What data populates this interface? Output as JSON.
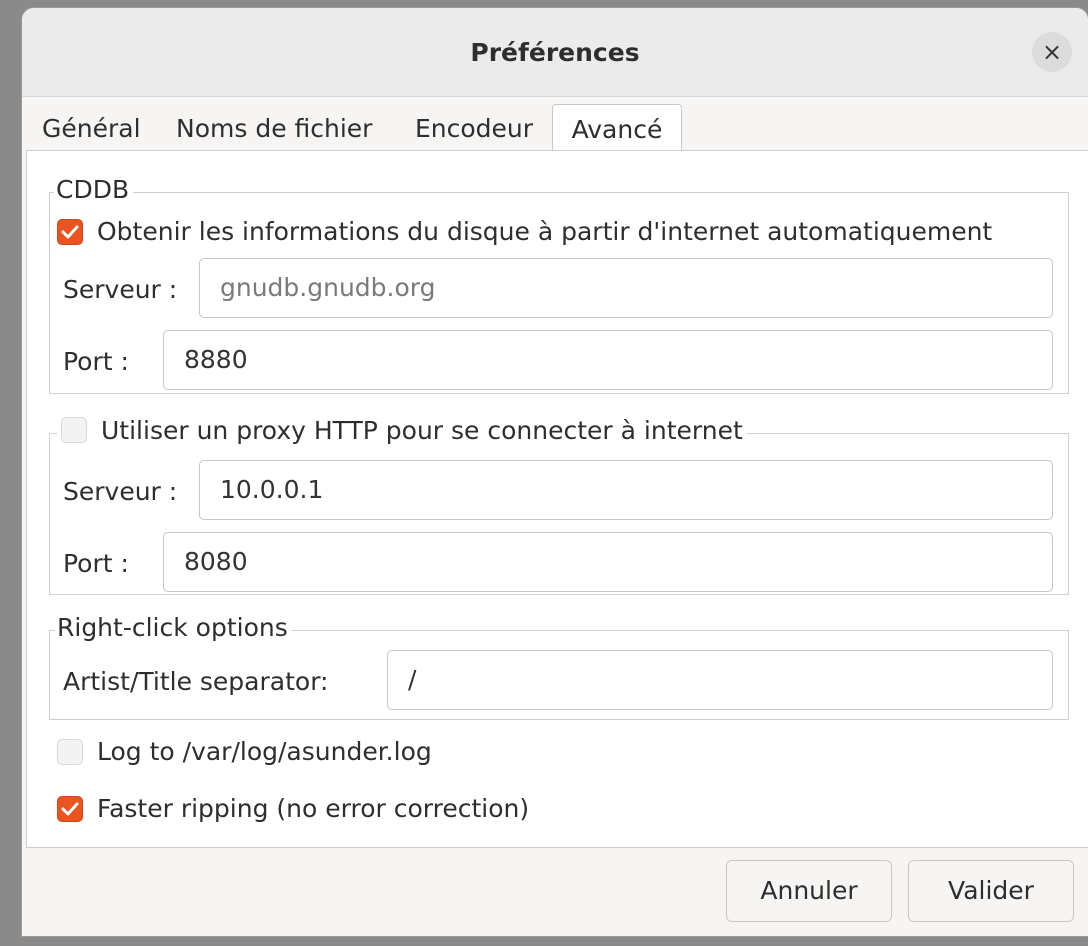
{
  "dialog": {
    "title": "Préférences",
    "close_glyph": "×"
  },
  "tabs": [
    {
      "label": "Général",
      "active": false
    },
    {
      "label": "Noms de fichier",
      "active": false
    },
    {
      "label": "Encodeur",
      "active": false
    },
    {
      "label": "Avancé",
      "active": true
    }
  ],
  "cddb": {
    "legend": "CDDB",
    "auto_fetch": {
      "label": "Obtenir les informations du disque à partir d'internet automatiquement",
      "checked": true
    },
    "server_label": "Serveur :",
    "server_value": "gnudb.gnudb.org",
    "port_label": "Port :",
    "port_value": "8880"
  },
  "proxy": {
    "use_proxy": {
      "label": "Utiliser un proxy HTTP pour se connecter à internet",
      "checked": false
    },
    "server_label": "Serveur :",
    "server_value": "10.0.0.1",
    "port_label": "Port :",
    "port_value": "8080"
  },
  "right_click": {
    "legend": "Right-click options",
    "separator_label": "Artist/Title separator:",
    "separator_value": "/"
  },
  "log": {
    "label": "Log to /var/log/asunder.log",
    "checked": false
  },
  "faster_ripping": {
    "label": "Faster ripping (no error correction)",
    "checked": true
  },
  "buttons": {
    "cancel": "Annuler",
    "ok": "Valider"
  },
  "colors": {
    "accent": "#e95420"
  }
}
